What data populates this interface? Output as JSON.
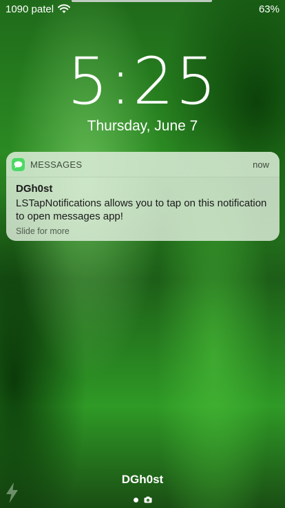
{
  "status_bar": {
    "carrier": "1090 patel",
    "battery": "63%",
    "wifi_icon": "wifi-icon"
  },
  "clock": {
    "time": "5:25",
    "date": "Thursday, June 7"
  },
  "notification": {
    "app_name": "MESSAGES",
    "app_icon": "messages-icon",
    "time": "now",
    "sender": "DGh0st",
    "message": "LSTapNotifications allows you to tap on this notification to open messages app!",
    "action_hint": "Slide for more"
  },
  "lock_screen": {
    "owner_name": "DGh0st",
    "flashlight_icon": "flashlight-icon",
    "camera_icon": "camera-icon"
  },
  "colors": {
    "messages_green": "#4cd964",
    "wallpaper_green": "#2b8a22"
  }
}
